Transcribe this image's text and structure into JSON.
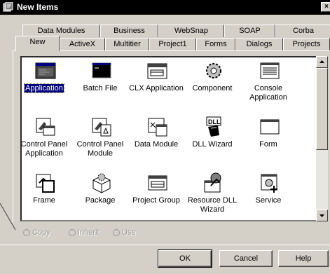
{
  "window": {
    "title": "New Items",
    "close_glyph": "×"
  },
  "tabs_back": [
    "Data Modules",
    "Business",
    "WebSnap",
    "SOAP",
    "Corba"
  ],
  "tabs_front": [
    "New",
    "ActiveX",
    "Multitier",
    "Project1",
    "Forms",
    "Dialogs",
    "Projects"
  ],
  "active_tab": "New",
  "items": [
    {
      "label": "Application",
      "icon": "application-icon",
      "selected": true
    },
    {
      "label": "Batch File",
      "icon": "batch-file-icon"
    },
    {
      "label": "CLX Application",
      "icon": "clx-application-icon"
    },
    {
      "label": "Component",
      "icon": "component-icon"
    },
    {
      "label": "Console Application",
      "icon": "console-application-icon"
    },
    {
      "label": "Control Panel Application",
      "icon": "control-panel-application-icon"
    },
    {
      "label": "Control Panel Module",
      "icon": "control-panel-module-icon"
    },
    {
      "label": "Data Module",
      "icon": "data-module-icon"
    },
    {
      "label": "DLL Wizard",
      "icon": "dll-wizard-icon"
    },
    {
      "label": "Form",
      "icon": "form-icon"
    },
    {
      "label": "Frame",
      "icon": "frame-icon"
    },
    {
      "label": "Package",
      "icon": "package-icon"
    },
    {
      "label": "Project Group",
      "icon": "project-group-icon"
    },
    {
      "label": "Resource DLL Wizard",
      "icon": "resource-dll-wizard-icon"
    },
    {
      "label": "Service",
      "icon": "service-icon"
    }
  ],
  "options": [
    "Copy",
    "Inherit",
    "Use"
  ],
  "buttons": {
    "ok": "OK",
    "cancel": "Cancel",
    "help": "Help"
  },
  "colors": {
    "selection": "#000080",
    "face": "#d4d0c8",
    "titlebar": "#000000"
  }
}
